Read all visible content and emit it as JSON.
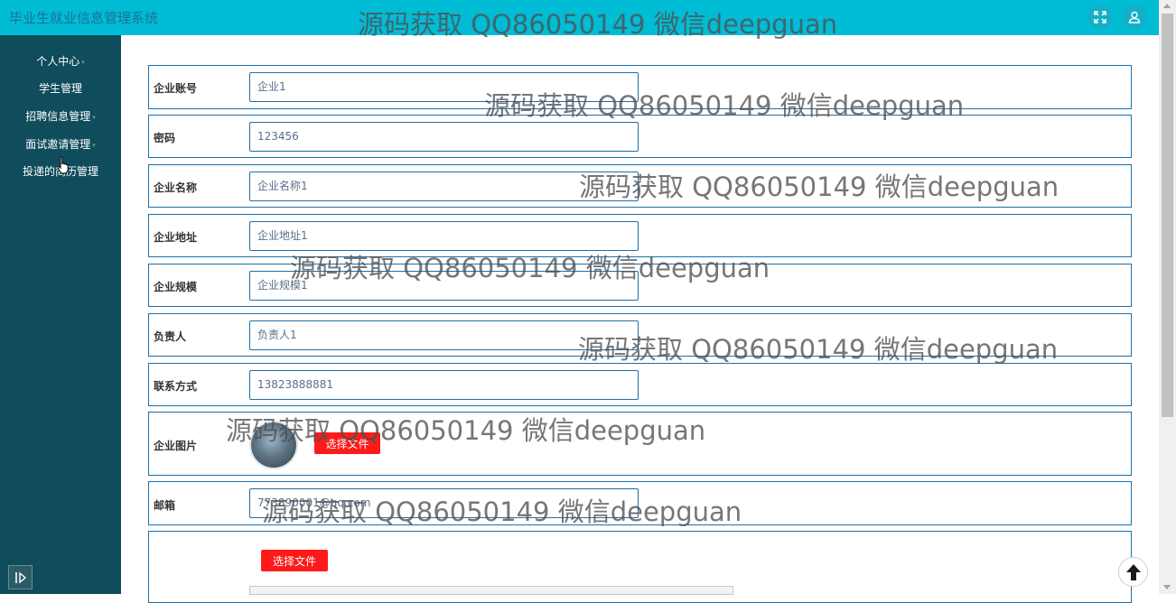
{
  "app": {
    "title": "毕业生就业信息管理系统"
  },
  "watermark": "源码获取 QQ86050149 微信deepguan",
  "header": {
    "icons": [
      "fullscreen-icon",
      "user-icon"
    ]
  },
  "sidebar": {
    "items": [
      {
        "label": "个人中心",
        "has_caret": true
      },
      {
        "label": "学生管理",
        "has_caret": false
      },
      {
        "label": "招聘信息管理",
        "has_caret": true
      },
      {
        "label": "面试邀请管理",
        "has_caret": true
      },
      {
        "label": "投递的简历管理",
        "has_caret": false
      }
    ]
  },
  "form": {
    "fields": [
      {
        "label": "企业账号",
        "value": "企业1"
      },
      {
        "label": "密码",
        "value": "123456"
      },
      {
        "label": "企业名称",
        "value": "企业名称1"
      },
      {
        "label": "企业地址",
        "value": "企业地址1"
      },
      {
        "label": "企业规模",
        "value": "企业规模1"
      },
      {
        "label": "负责人",
        "value": "负责人1"
      },
      {
        "label": "联系方式",
        "value": "13823888881"
      }
    ],
    "image_field": {
      "label": "企业图片",
      "button": "选择文件"
    },
    "email_field": {
      "label": "邮箱",
      "value": "773890001@qq.com"
    },
    "rich_field": {
      "button": "选择文件"
    }
  },
  "colors": {
    "topbar": "#00bcd4",
    "sidebar": "#0f4c5c",
    "field_border": "#1f6fa8",
    "file_button": "#ff1a1a"
  }
}
